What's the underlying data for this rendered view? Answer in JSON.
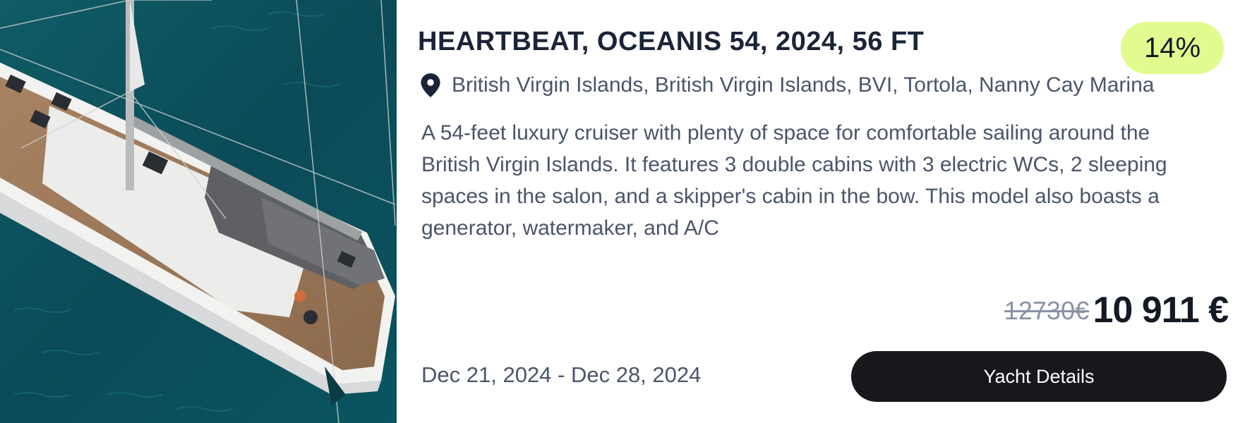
{
  "listing": {
    "title": "HEARTBEAT, OCEANIS 54, 2024, 56 FT",
    "discount_badge": "14%",
    "location": "British Virgin Islands, British Virgin Islands, BVI, Tortola, Nanny Cay Marina",
    "location_icon": "map-pin-icon",
    "description": "A 54-feet luxury cruiser with plenty of space for comfortable sailing around the British Virgin Islands. It features 3 double cabins with 3 electric WCs, 2 sleeping spaces in the salon, and a skipper's cabin in the bow. This model also boasts a generator, watermaker, and A/C",
    "old_price": "12730€",
    "price": "10 911 €",
    "dates": "Dec 21, 2024 - Dec 28, 2024",
    "details_button_label": "Yacht Details"
  },
  "colors": {
    "badge_bg": "#e2fb8f",
    "button_bg": "#16181b",
    "title": "#1b2437",
    "body_text": "#4b5568",
    "sea": "#0d4e5a"
  }
}
